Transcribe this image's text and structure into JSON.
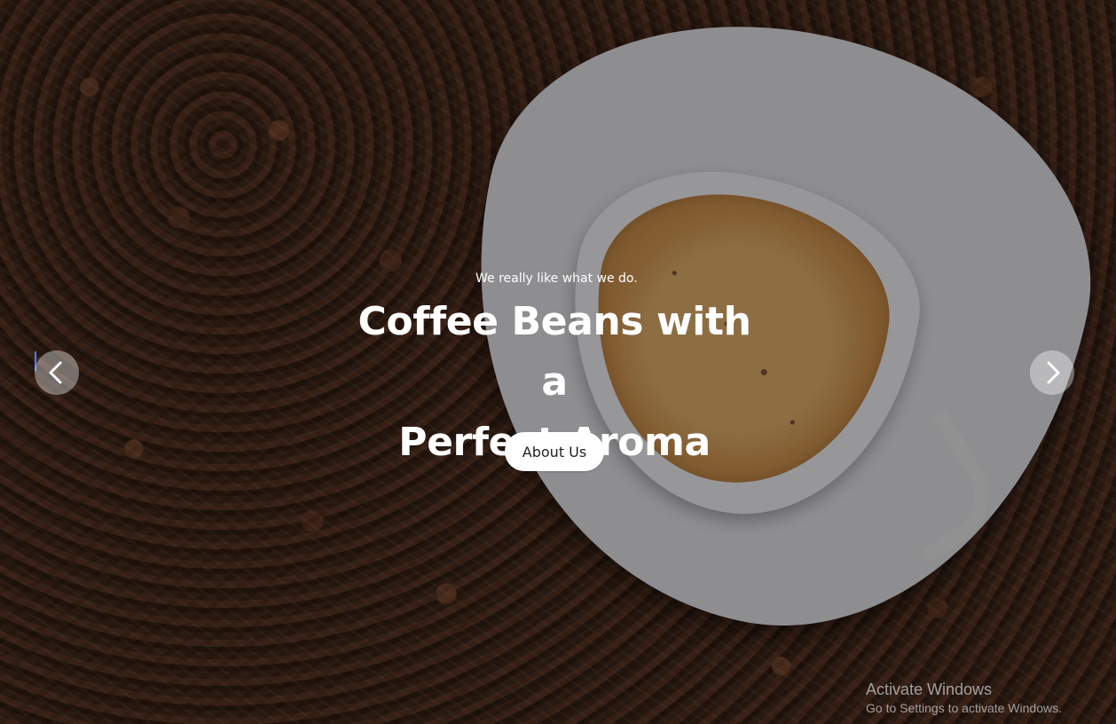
{
  "hero": {
    "eyebrow": "We really like what we do.",
    "headline_line_1": "Coffee Beans with a",
    "headline_line_2": "Perfect Aroma",
    "cta_label": "About Us"
  },
  "carousel": {
    "previous_icon": "chevron-left-icon",
    "next_icon": "chevron-right-icon"
  },
  "watermark": {
    "title": "Activate Windows",
    "subtitle": "Go to Settings to activate Windows."
  },
  "colors": {
    "overlay": "#00000057",
    "button_background": "#ffffff",
    "button_text": "#222222",
    "headline_text": "#ffffff"
  }
}
